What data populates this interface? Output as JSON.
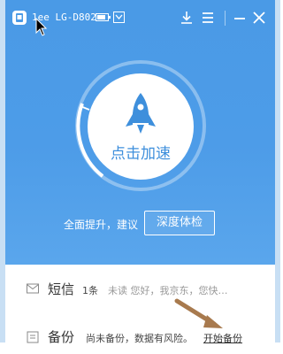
{
  "titlebar": {
    "device_name": "1ee LG-D802",
    "icons": [
      "phone-app-icon",
      "battery-icon",
      "chevron-down-icon",
      "download-icon",
      "menu-icon",
      "minimize-icon",
      "close-icon"
    ]
  },
  "main": {
    "boost_label": "点击加速",
    "hint_text": "全面提升，建议",
    "check_button": "深度体检"
  },
  "rows": {
    "sms": {
      "title": "短信",
      "count": "1条",
      "preview": "未读 您好，我京东，您快…"
    },
    "backup": {
      "title": "备份",
      "status": "尚未备份，数据有风险。",
      "action": "开始备份"
    }
  },
  "colors": {
    "accent_blue": "#4a9ae6",
    "annotation_arrow": "#a87a4e"
  }
}
